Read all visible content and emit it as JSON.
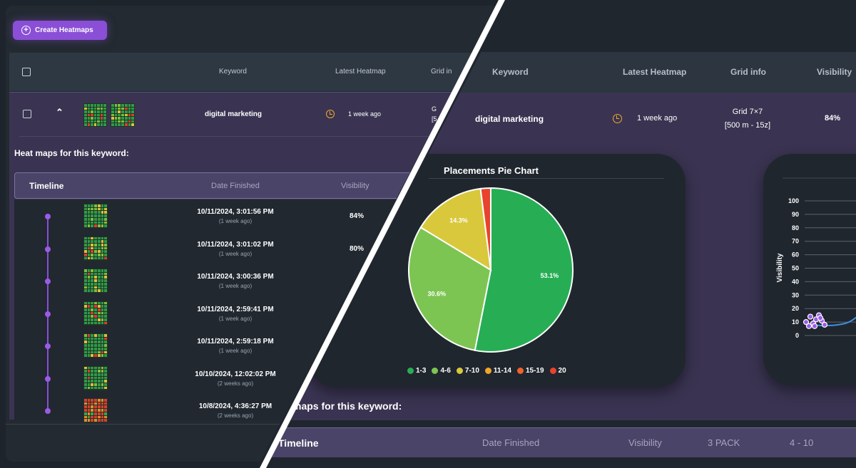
{
  "toolbar": {
    "create_label": "Create Heatmaps"
  },
  "left_table": {
    "headers": {
      "keyword": "Keyword",
      "latest": "Latest Heatmap",
      "grid": "Grid in"
    },
    "row": {
      "keyword": "digital marketing",
      "ago": "1 week ago",
      "grid_line1": "G",
      "grid_line2": "[5"
    },
    "subtitle": "Heat maps for this keyword:",
    "timeline_headers": {
      "timeline": "Timeline",
      "date": "Date Finished",
      "visibility": "Visibility"
    },
    "timeline": [
      {
        "date": "10/11/2024, 3:01:56 PM",
        "rel": "(1 week ago)",
        "vis": "84%"
      },
      {
        "date": "10/11/2024, 3:01:02 PM",
        "rel": "(1 week ago)",
        "vis": "80%"
      },
      {
        "date": "10/11/2024, 3:00:36 PM",
        "rel": "(1 week ago)",
        "vis": ""
      },
      {
        "date": "10/11/2024, 2:59:41 PM",
        "rel": "(1 week ago)",
        "vis": ""
      },
      {
        "date": "10/11/2024, 2:59:18 PM",
        "rel": "(1 week ago)",
        "vis": ""
      },
      {
        "date": "10/10/2024, 12:02:02 PM",
        "rel": "(2 weeks ago)",
        "vis": ""
      },
      {
        "date": "10/8/2024, 4:36:27 PM",
        "rel": "(2 weeks ago)",
        "vis": ""
      }
    ]
  },
  "right_table": {
    "headers": {
      "keyword": "Keyword",
      "latest": "Latest Heatmap",
      "grid": "Grid info",
      "visibility": "Visibility"
    },
    "row": {
      "keyword": "digital marketing",
      "ago": "1 week ago",
      "grid_line1": "Grid 7×7",
      "grid_line2": "[500 m - 15z]",
      "visibility": "84%"
    },
    "subtitle": "maps for this keyword:",
    "timeline_headers": {
      "timeline": "Timeline",
      "date": "Date Finished",
      "visibility": "Visibility",
      "pack": "3 PACK",
      "range": "4 - 10"
    }
  },
  "colors": {
    "accent": "#8a4fd6",
    "row_bg": "#3a3452",
    "clock": "#f0a92e"
  },
  "chart_data": [
    {
      "type": "pie",
      "title": "Placements Pie Chart",
      "categories": [
        "1-3",
        "4-6",
        "7-10",
        "11-14",
        "15-19",
        "20"
      ],
      "values": [
        53.1,
        30.6,
        14.3,
        0,
        0,
        2.0
      ],
      "labels": [
        "53.1%",
        "30.6%",
        "14.3%",
        "",
        "",
        ""
      ],
      "colors": [
        "#27ae55",
        "#7cc552",
        "#d9c83c",
        "#f0a52b",
        "#f0632b",
        "#e8432e"
      ],
      "legend": "bottom"
    },
    {
      "type": "line",
      "ylabel": "Visibility",
      "ylim": [
        0,
        100
      ],
      "yticks": [
        0,
        10,
        20,
        30,
        40,
        50,
        60,
        70,
        80,
        90,
        100
      ],
      "grid": true
    }
  ]
}
